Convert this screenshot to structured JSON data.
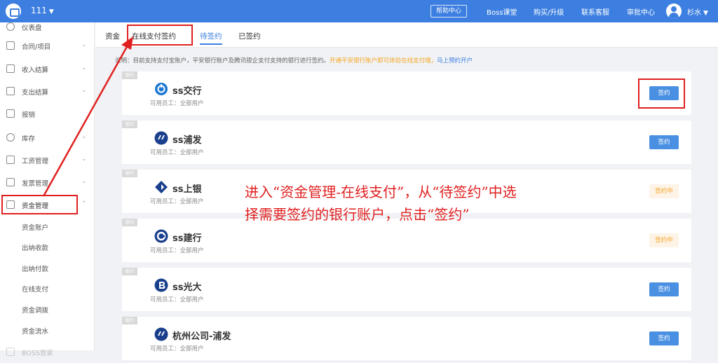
{
  "topbar": {
    "org_name": "111",
    "help_label": "帮助中心",
    "links": [
      "Boss课堂",
      "购买/升级",
      "联系客服",
      "审批中心"
    ],
    "user_name": "杉水"
  },
  "sidebar": {
    "items": [
      {
        "label": "仪表盘",
        "icon": "dashboard-icon"
      },
      {
        "label": "合同/项目",
        "icon": "folder-icon"
      },
      {
        "label": "收入结算",
        "icon": "income-icon"
      },
      {
        "label": "支出结算",
        "icon": "expense-icon"
      },
      {
        "label": "报销",
        "icon": "reimburse-icon"
      },
      {
        "label": "库存",
        "icon": "inventory-icon"
      },
      {
        "label": "工资管理",
        "icon": "salary-icon"
      },
      {
        "label": "发票管理",
        "icon": "invoice-icon"
      },
      {
        "label": "资金管理",
        "icon": "funds-icon"
      }
    ],
    "sub_items": [
      "资金账户",
      "出纳收款",
      "出纳付款",
      "在线支付",
      "资金调拨",
      "资金流水"
    ],
    "bottom_item": "BOSS管家"
  },
  "breadcrumb": {
    "root": "资金",
    "current": "在线支付签约"
  },
  "tabs": [
    "待签约",
    "已签约"
  ],
  "note": {
    "prefix": "说明：目前支持支付宝账户，平安银行账户及腾讯银企支付支持的银行进行签约。",
    "orange": "开通平安银行账户即可体验在线支付哦，",
    "link": "马上预约开户"
  },
  "cards": [
    {
      "tag": "银行",
      "name": "ss交行",
      "sub": "可用员工：全部用户",
      "action": "签约",
      "status": "sign",
      "icon_color": "#1e78d2"
    },
    {
      "tag": "银行",
      "name": "ss浦发",
      "sub": "可用员工：全部用户",
      "action": "签约",
      "status": "sign",
      "icon_color": "#1a3f8c"
    },
    {
      "tag": "银行",
      "name": "ss上银",
      "sub": "可用员工：全部用户",
      "action": "签约中",
      "status": "pending",
      "icon_color": "#1a3f8c"
    },
    {
      "tag": "银行",
      "name": "ss建行",
      "sub": "可用员工：全部用户",
      "action": "签约中",
      "status": "pending",
      "icon_color": "#1a3f8c"
    },
    {
      "tag": "银行",
      "name": "ss光大",
      "sub": "可用员工：全部用户",
      "action": "签约",
      "status": "sign",
      "icon_color": "#1a3f8c"
    },
    {
      "tag": "银行",
      "name": "杭州公司-浦发",
      "sub": "可用员工：全部用户",
      "action": "签约",
      "status": "sign",
      "icon_color": "#1a3f8c"
    }
  ],
  "annotation": {
    "line1": "进入“资金管理-在线支付”，从“待签约”中选",
    "line2": "择需要签约的银行账户，点击“签约”"
  },
  "colors": {
    "primary": "#3d7fe0",
    "highlight": "#e02020",
    "pending": "#f5a623"
  }
}
